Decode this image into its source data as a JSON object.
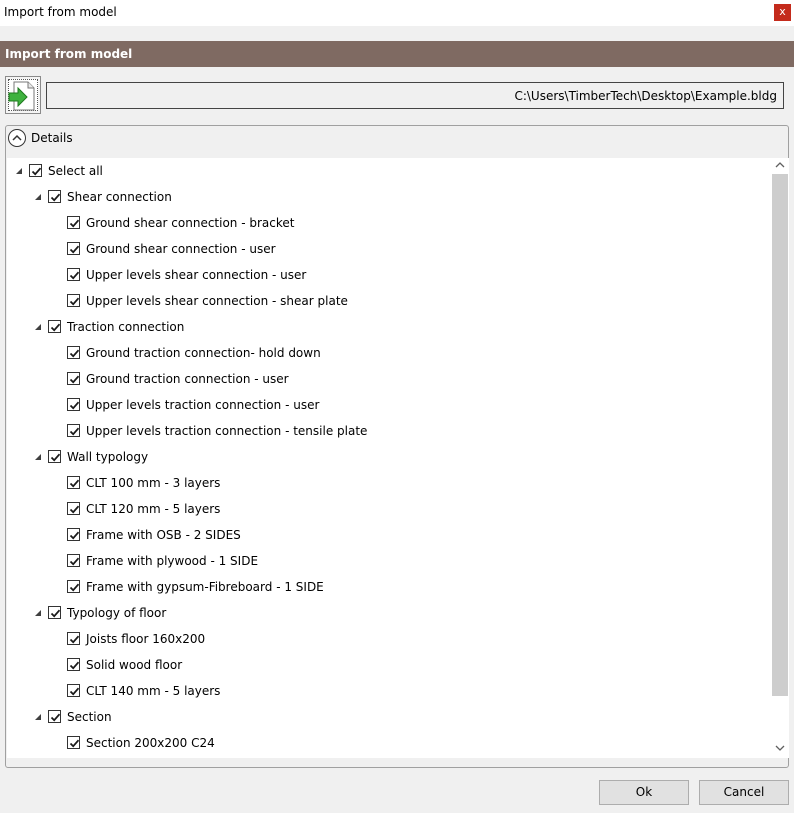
{
  "window": {
    "title": "Import from model",
    "close_glyph": "x"
  },
  "header": {
    "title": "Import from model"
  },
  "import": {
    "icon": "import-arrow-icon",
    "file_path": "C:\\Users\\TimberTech\\Desktop\\Example.bldg"
  },
  "details": {
    "label": "Details",
    "expanded": true
  },
  "tree": {
    "items": [
      {
        "label": "Select all",
        "level": 0,
        "checked": true,
        "expandable": true
      },
      {
        "label": "Shear connection",
        "level": 1,
        "checked": true,
        "expandable": true
      },
      {
        "label": "Ground shear connection - bracket",
        "level": 2,
        "checked": true,
        "expandable": false
      },
      {
        "label": "Ground shear connection - user",
        "level": 2,
        "checked": true,
        "expandable": false
      },
      {
        "label": "Upper levels shear connection - user",
        "level": 2,
        "checked": true,
        "expandable": false
      },
      {
        "label": "Upper levels shear connection - shear plate",
        "level": 2,
        "checked": true,
        "expandable": false
      },
      {
        "label": "Traction connection",
        "level": 1,
        "checked": true,
        "expandable": true
      },
      {
        "label": "Ground traction connection- hold down",
        "level": 2,
        "checked": true,
        "expandable": false
      },
      {
        "label": "Ground traction connection - user",
        "level": 2,
        "checked": true,
        "expandable": false
      },
      {
        "label": "Upper levels traction connection - user",
        "level": 2,
        "checked": true,
        "expandable": false
      },
      {
        "label": "Upper levels traction connection - tensile plate",
        "level": 2,
        "checked": true,
        "expandable": false
      },
      {
        "label": "Wall typology",
        "level": 1,
        "checked": true,
        "expandable": true
      },
      {
        "label": "CLT 100 mm - 3 layers",
        "level": 2,
        "checked": true,
        "expandable": false
      },
      {
        "label": "CLT 120 mm - 5 layers",
        "level": 2,
        "checked": true,
        "expandable": false
      },
      {
        "label": "Frame with OSB - 2 SIDES",
        "level": 2,
        "checked": true,
        "expandable": false
      },
      {
        "label": "Frame with plywood - 1 SIDE",
        "level": 2,
        "checked": true,
        "expandable": false
      },
      {
        "label": "Frame with gypsum-Fibreboard - 1 SIDE",
        "level": 2,
        "checked": true,
        "expandable": false
      },
      {
        "label": "Typology of floor",
        "level": 1,
        "checked": true,
        "expandable": true
      },
      {
        "label": "Joists floor 160x200",
        "level": 2,
        "checked": true,
        "expandable": false
      },
      {
        "label": "Solid wood floor",
        "level": 2,
        "checked": true,
        "expandable": false
      },
      {
        "label": "CLT 140 mm - 5 layers",
        "level": 2,
        "checked": true,
        "expandable": false
      },
      {
        "label": "Section",
        "level": 1,
        "checked": true,
        "expandable": true
      },
      {
        "label": "Section 200x200 C24",
        "level": 2,
        "checked": true,
        "expandable": false
      }
    ]
  },
  "buttons": {
    "ok_label": "Ok",
    "cancel_label": "Cancel"
  },
  "colors": {
    "header_band": "#7f6a62",
    "close_button": "#c42b1c"
  }
}
